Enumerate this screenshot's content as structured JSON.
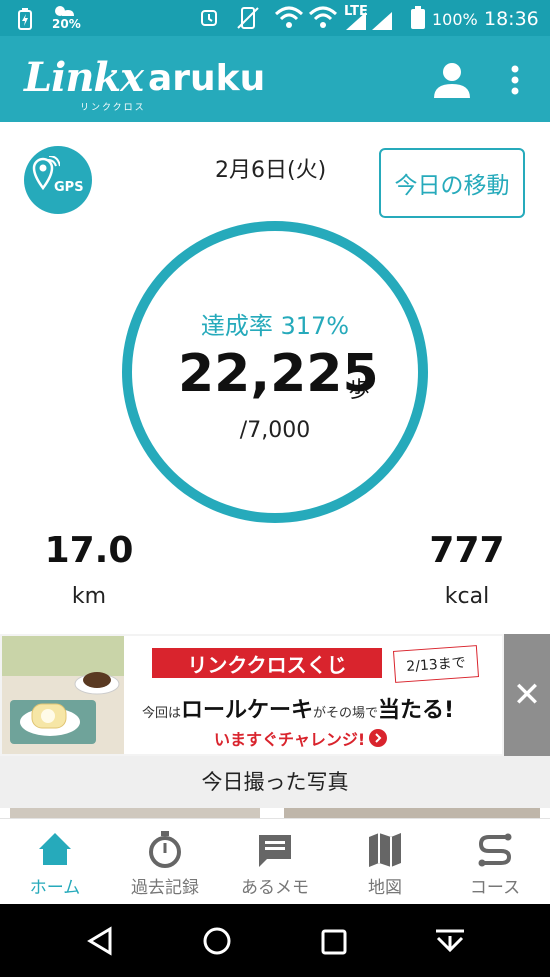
{
  "status_bar": {
    "weather_pct": "20%",
    "network": "LTE",
    "battery": "100%",
    "time": "18:36"
  },
  "app_bar": {
    "logo_script": "Linkx",
    "logo_word": "aruku",
    "logo_sub": "リンククロス",
    "icons": [
      "account-icon",
      "more-vertical-icon"
    ]
  },
  "dashboard": {
    "gps_label": "GPS",
    "date": "2月6日(火)",
    "today_move_button": "今日の移動",
    "achievement": "達成率 317%",
    "steps": "22,225",
    "steps_unit": "歩",
    "goal": "/7,000",
    "distance_value": "17.0",
    "distance_unit": "km",
    "calories_value": "777",
    "calories_unit": "kcal"
  },
  "banner": {
    "ribbon": "リンククロスくじ",
    "deadline": "2/13まで",
    "line_prefix": "今回は",
    "line_item": "ロールケーキ",
    "line_mid": "がその場で",
    "line_win": "当たる!",
    "cta": "いますぐチャレンジ!",
    "close": "✕"
  },
  "photos": {
    "title": "今日撮った写真"
  },
  "bottom_nav": {
    "items": [
      {
        "label": "ホーム",
        "icon": "home-icon",
        "active": true
      },
      {
        "label": "過去記録",
        "icon": "stopwatch-icon",
        "active": false
      },
      {
        "label": "あるメモ",
        "icon": "memo-icon",
        "active": false
      },
      {
        "label": "地図",
        "icon": "map-icon",
        "active": false
      },
      {
        "label": "コース",
        "icon": "course-icon",
        "active": false
      }
    ]
  },
  "colors": {
    "primary": "#26aabb",
    "status_bar": "#1a9fb0",
    "promo_red": "#d9242d"
  }
}
